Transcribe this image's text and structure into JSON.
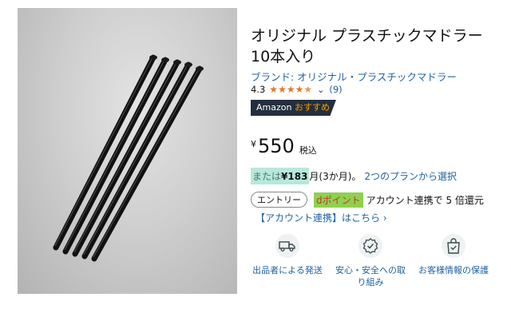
{
  "product": {
    "title": "オリジナル プラスチックマドラー10本入り",
    "brand": "ブランド: オリジナル・プラスチックマドラー",
    "rating": "4.3",
    "stars": [
      "full",
      "full",
      "full",
      "full",
      "half"
    ],
    "review_count": "(9)",
    "badge_prefix": "Amazon ",
    "badge_accent": "おすすめ"
  },
  "price": {
    "currency": "¥",
    "amount": "550",
    "tax": "税込"
  },
  "installment": {
    "prefix": "または",
    "amount": "¥183",
    "suffix": " 月(3か月)。",
    "plans_link": "2つのプランから選択"
  },
  "points": {
    "tag": "エントリー",
    "dpoint": "dポイント",
    "text": "アカウント連携で 5 倍還元",
    "link": "【アカウント連携】はこちら ›"
  },
  "features": [
    {
      "icon": "delivery-truck-icon",
      "label": "出品者による発送"
    },
    {
      "icon": "security-badge-icon",
      "label": "安心・安全への取り組み"
    },
    {
      "icon": "secure-bag-icon",
      "label": "お客様情報の保護"
    }
  ],
  "colors": {
    "link": "#2162a1",
    "star": "#de7921",
    "badge_bg": "#232f3e",
    "badge_accent": "#ff9900",
    "installment_bg": "#b8e8db",
    "dpoint_bg": "#8fd14f",
    "dpoint_text": "#c0392b"
  }
}
